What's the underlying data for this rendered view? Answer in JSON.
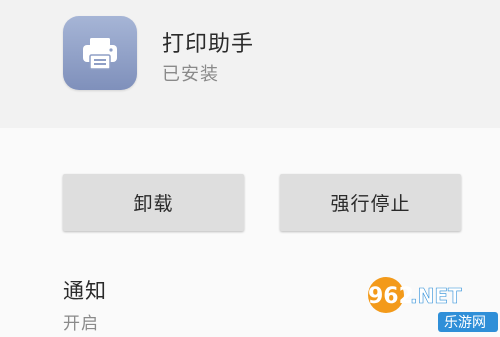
{
  "app": {
    "name": "打印助手",
    "status": "已安装",
    "icon": "printer-icon"
  },
  "actions": {
    "uninstall_label": "卸载",
    "force_stop_label": "强行停止"
  },
  "notification": {
    "title": "通知",
    "value": "开启"
  },
  "watermark": {
    "brand": "962.NET",
    "site": "乐游网"
  },
  "colors": {
    "icon_top": "#a6b5d6",
    "icon_bottom": "#7f90bb",
    "watermark_orange": "#f39a1a",
    "watermark_blue": "#2f8fd8"
  }
}
